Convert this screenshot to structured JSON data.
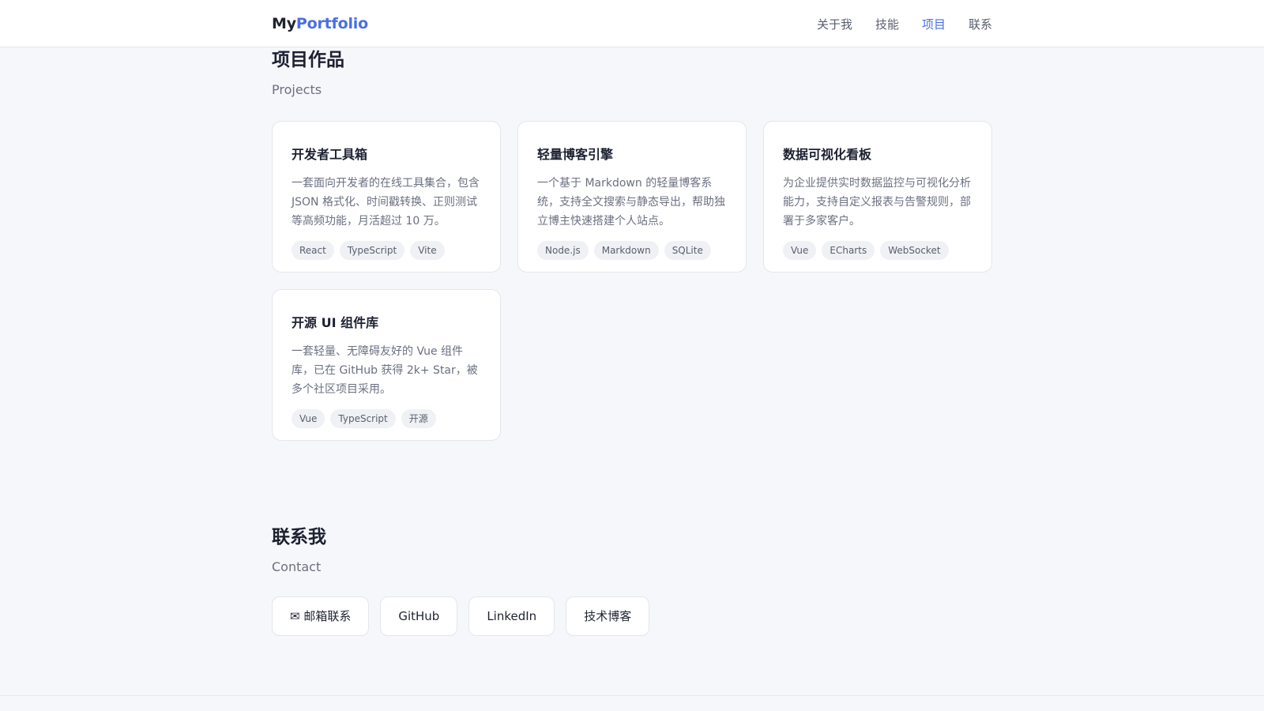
{
  "nav": {
    "brand_prefix": "My",
    "brand_accent": "Portfolio",
    "links": [
      {
        "label": "关于我",
        "active": false
      },
      {
        "label": "技能",
        "active": false
      },
      {
        "label": "项目",
        "active": true
      },
      {
        "label": "联系",
        "active": false
      }
    ]
  },
  "projects": {
    "title": "项目作品",
    "subtitle": "Projects",
    "cards": [
      {
        "title": "开发者工具箱",
        "desc": "一套面向开发者的在线工具集合，包含 JSON 格式化、时间戳转换、正则测试等高频功能，月活超过 10 万。",
        "tags": [
          "React",
          "TypeScript",
          "Vite"
        ]
      },
      {
        "title": "轻量博客引擎",
        "desc": "一个基于 Markdown 的轻量博客系统，支持全文搜索与静态导出，帮助独立博主快速搭建个人站点。",
        "tags": [
          "Node.js",
          "Markdown",
          "SQLite"
        ]
      },
      {
        "title": "数据可视化看板",
        "desc": "为企业提供实时数据监控与可视化分析能力，支持自定义报表与告警规则，部署于多家客户。",
        "tags": [
          "Vue",
          "ECharts",
          "WebSocket"
        ]
      },
      {
        "title": "开源 UI 组件库",
        "desc": "一套轻量、无障碍友好的 Vue 组件库，已在 GitHub 获得 2k+ Star，被多个社区项目采用。",
        "tags": [
          "Vue",
          "TypeScript",
          "开源"
        ]
      }
    ]
  },
  "contact": {
    "title": "联系我",
    "subtitle": "Contact",
    "buttons": [
      {
        "label": "✉ 邮箱联系"
      },
      {
        "label": "GitHub"
      },
      {
        "label": "LinkedIn"
      },
      {
        "label": "技术博客"
      }
    ]
  },
  "colors": {
    "accent": "#4a6fe3",
    "background": "#f6f7fa"
  }
}
